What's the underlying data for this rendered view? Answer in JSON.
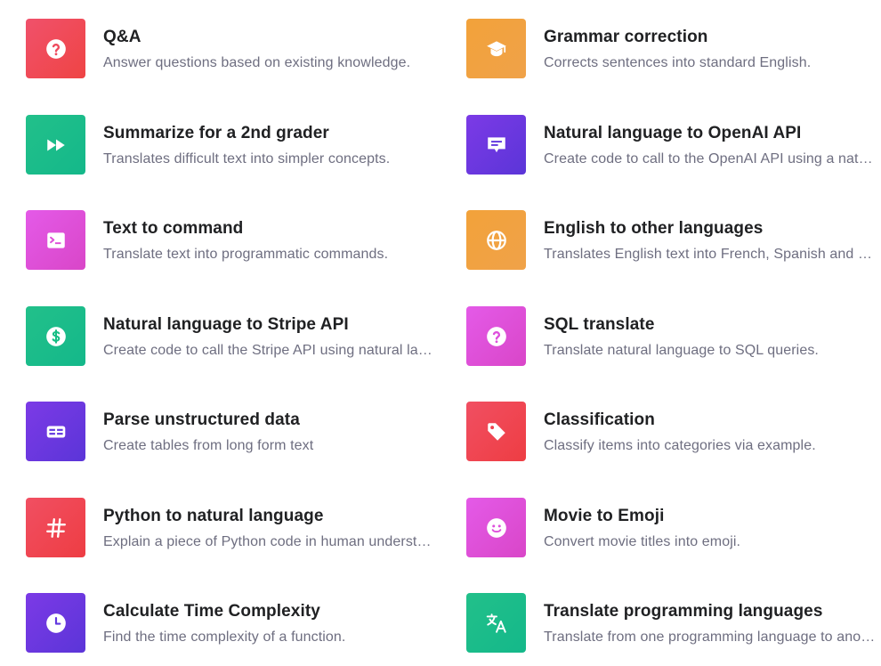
{
  "examples": [
    {
      "title": "Q&A",
      "description": "Answer questions based on existing knowledge.",
      "icon": "question-icon",
      "color": "#ef4565"
    },
    {
      "title": "Grammar correction",
      "description": "Corrects sentences into standard English.",
      "icon": "graduation-cap-icon",
      "color": "#f2a23f"
    },
    {
      "title": "Summarize for a 2nd grader",
      "description": "Translates difficult text into simpler concepts.",
      "icon": "fast-forward-icon",
      "color": "#19c37d"
    },
    {
      "title": "Natural language to OpenAI API",
      "description": "Create code to call to the OpenAI API using a natural language instruction.",
      "icon": "chat-icon",
      "color": "#6b3de2"
    },
    {
      "title": "Text to command",
      "description": "Translate text into programmatic commands.",
      "icon": "terminal-icon",
      "color": "#e152e0"
    },
    {
      "title": "English to other languages",
      "description": "Translates English text into French, Spanish and Japanese.",
      "icon": "globe-icon",
      "color": "#f2a23f"
    },
    {
      "title": "Natural language to Stripe API",
      "description": "Create code to call the Stripe API using natural language.",
      "icon": "dollar-icon",
      "color": "#19c37d"
    },
    {
      "title": "SQL translate",
      "description": "Translate natural language to SQL queries.",
      "icon": "question-icon",
      "color": "#e152e0"
    },
    {
      "title": "Parse unstructured data",
      "description": "Create tables from long form text",
      "icon": "table-icon",
      "color": "#6b3de2"
    },
    {
      "title": "Classification",
      "description": "Classify items into categories via example.",
      "icon": "tag-icon",
      "color": "#ef4146"
    },
    {
      "title": "Python to natural language",
      "description": "Explain a piece of Python code in human understandable language.",
      "icon": "hash-icon",
      "color": "#ef4146"
    },
    {
      "title": "Movie to Emoji",
      "description": "Convert movie titles into emoji.",
      "icon": "smile-icon",
      "color": "#e152e0"
    },
    {
      "title": "Calculate Time Complexity",
      "description": "Find the time complexity of a function.",
      "icon": "clock-icon",
      "color": "#6b3de2"
    },
    {
      "title": "Translate programming languages",
      "description": "Translate from one programming language to another.",
      "icon": "translate-icon",
      "color": "#19c37d"
    }
  ]
}
